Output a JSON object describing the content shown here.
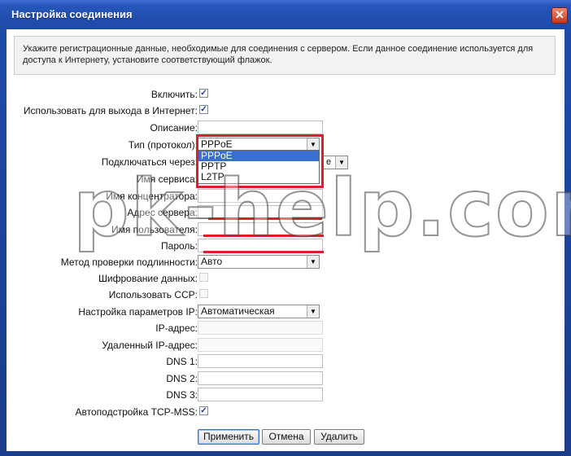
{
  "window": {
    "title": "Настройка соединения",
    "close_glyph": "✕"
  },
  "info_text": "Укажите регистрационные данные, необходимые для соединения с сервером. Если данное соединение используется для доступа к Интернету, установите соответствующий флажок.",
  "form": {
    "enable": {
      "label": "Включить:",
      "checked": true
    },
    "internet": {
      "label": "Использовать для выхода в Интернет:",
      "checked": true
    },
    "description": {
      "label": "Описание:",
      "value": ""
    },
    "protocol": {
      "label": "Тип (протокол):",
      "value": "PPPoE",
      "options": [
        "PPPoE",
        "PPTP",
        "L2TP"
      ]
    },
    "connect_via": {
      "label": "Подключаться через:",
      "value_partial": "е"
    },
    "service_name": {
      "label": "Имя сервиса:"
    },
    "concentrator": {
      "label": "Имя концентратора:"
    },
    "server_address": {
      "label": "Адрес сервера:"
    },
    "username": {
      "label": "Имя пользователя:"
    },
    "password": {
      "label": "Пароль:"
    },
    "auth_method": {
      "label": "Метод проверки подлинности:",
      "value": "Авто"
    },
    "encryption": {
      "label": "Шифрование данных:"
    },
    "ccp": {
      "label": "Использовать CCP:"
    },
    "ip_settings": {
      "label": "Настройка параметров IP:",
      "value": "Автоматическая"
    },
    "ip_address": {
      "label": "IP-адрес:"
    },
    "remote_ip": {
      "label": "Удаленный IP-адрес:"
    },
    "dns1": {
      "label": "DNS 1:"
    },
    "dns2": {
      "label": "DNS 2:"
    },
    "dns3": {
      "label": "DNS 3:"
    },
    "tcp_mss": {
      "label": "Автоподстройка TCP-MSS:",
      "checked": true
    }
  },
  "buttons": {
    "apply": "Применить",
    "cancel": "Отмена",
    "delete": "Удалить"
  },
  "watermark": "pk-help.com",
  "check_glyph": "✓",
  "arrow_glyph": "▼",
  "colors": {
    "title_bar": "#2555b8",
    "highlight": "#d8222a",
    "selected_option": "#3a6fd0"
  }
}
